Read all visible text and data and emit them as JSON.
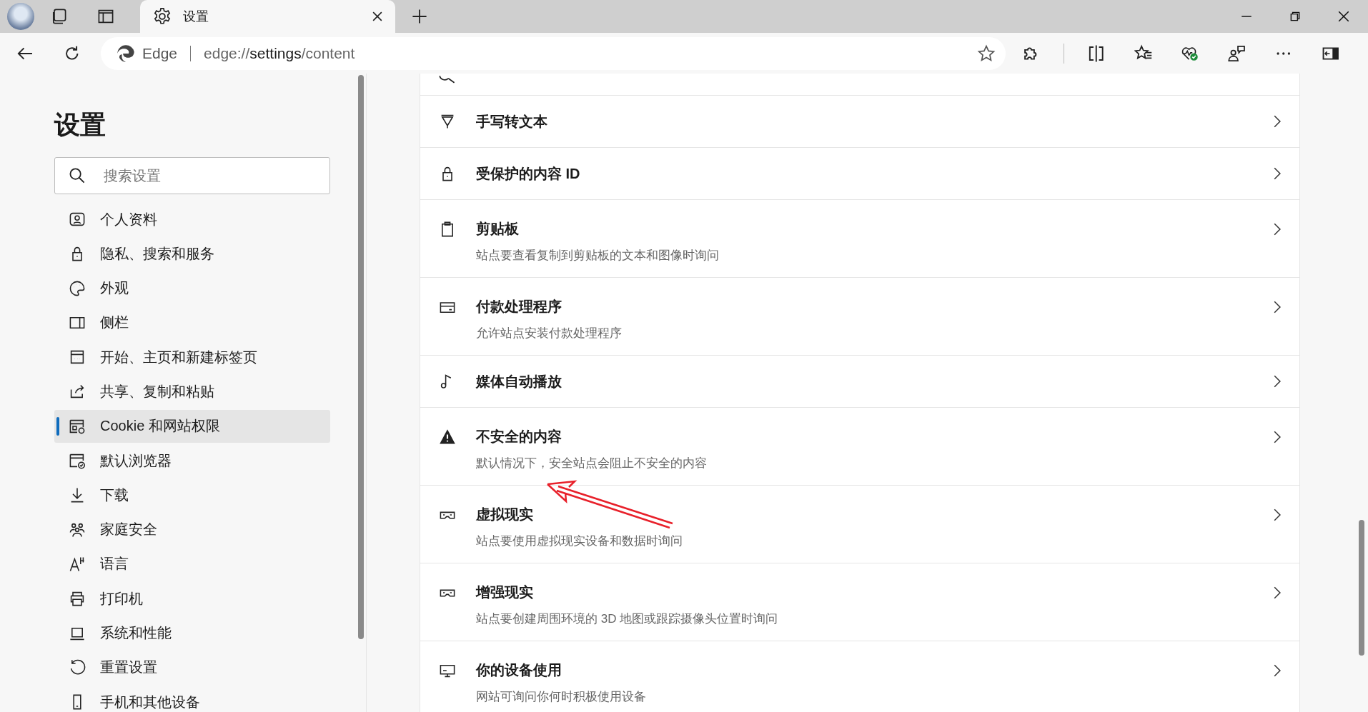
{
  "tabs": [
    {
      "label": "设置",
      "selected": true
    }
  ],
  "address_bar": {
    "site": "Edge",
    "url_prefix": "edge://",
    "url_host": "settings",
    "url_path": "/content"
  },
  "sidebar": {
    "title": "设置",
    "search": {
      "placeholder": "搜索设置"
    },
    "items": [
      {
        "label": "个人资料",
        "selected": false
      },
      {
        "label": "隐私、搜索和服务",
        "selected": false
      },
      {
        "label": "外观",
        "selected": false
      },
      {
        "label": "侧栏",
        "selected": false
      },
      {
        "label": "开始、主页和新建标签页",
        "selected": false
      },
      {
        "label": "共享、复制和粘贴",
        "selected": false
      },
      {
        "label": "Cookie 和网站权限",
        "selected": true
      },
      {
        "label": "默认浏览器",
        "selected": false
      },
      {
        "label": "下载",
        "selected": false
      },
      {
        "label": "家庭安全",
        "selected": false
      },
      {
        "label": "语言",
        "selected": false
      },
      {
        "label": "打印机",
        "selected": false
      },
      {
        "label": "系统和性能",
        "selected": false
      },
      {
        "label": "重置设置",
        "selected": false
      },
      {
        "label": "手机和其他设备",
        "selected": false
      }
    ]
  },
  "permissions": [
    {
      "title": "手写转文本"
    },
    {
      "title": "受保护的内容 ID"
    },
    {
      "title": "剪贴板",
      "description": "站点要查看复制到剪贴板的文本和图像时询问"
    },
    {
      "title": "付款处理程序",
      "description": "允许站点安装付款处理程序"
    },
    {
      "title": "媒体自动播放"
    },
    {
      "title": "不安全的内容",
      "description": "默认情况下，安全站点会阻止不安全的内容"
    },
    {
      "title": "虚拟现实",
      "description": "站点要使用虚拟现实设备和数据时询问"
    },
    {
      "title": "增强现实",
      "description": "站点要创建周围环境的 3D 地图或跟踪摄像头位置时询问"
    },
    {
      "title": "你的设备使用",
      "description": "网站可询问你何时积极使用设备"
    }
  ]
}
